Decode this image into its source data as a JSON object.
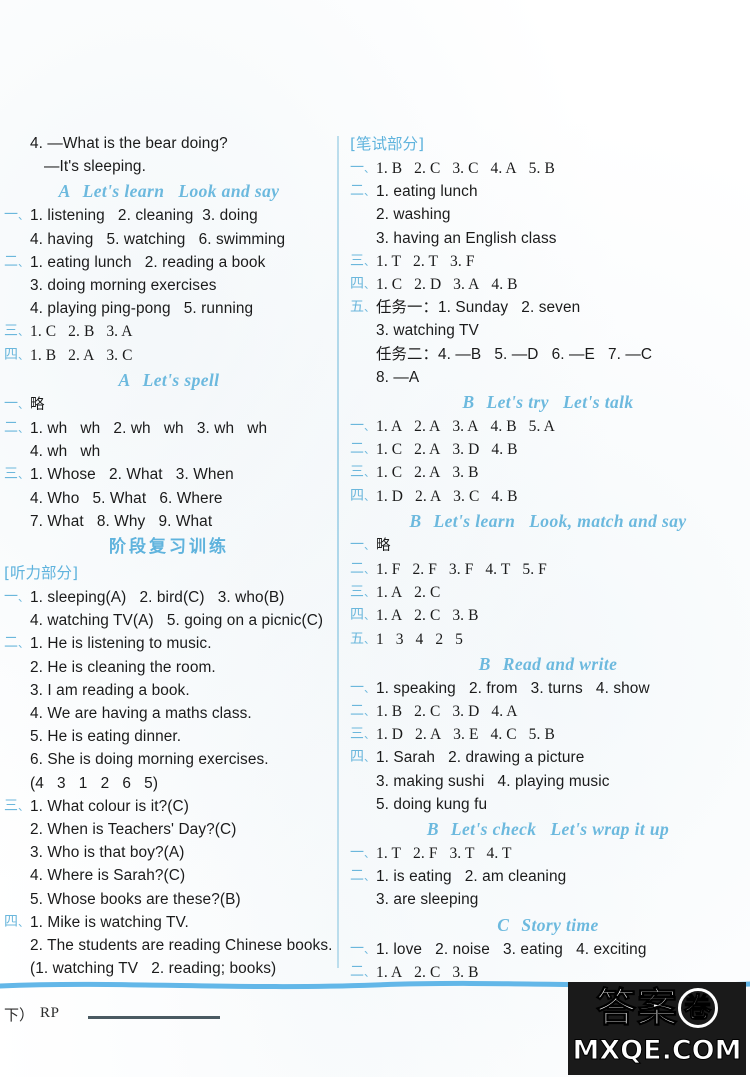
{
  "document": {
    "kind": "answer-key-page",
    "footer": {
      "page_label": "下）",
      "edition_code": "RP"
    },
    "watermark": {
      "chinese": "答案",
      "circled_char": "卷",
      "domain": "MXQE.COM"
    }
  },
  "left_column": {
    "blocks": [
      {
        "type": "lines",
        "lines": [
          {
            "indent": 1,
            "text": "4. —What is the bear doing?"
          },
          {
            "indent": 2,
            "text": "—It's sleeping."
          }
        ]
      },
      {
        "type": "heading",
        "tag": "A",
        "parts": [
          "Let's learn",
          "Look and say"
        ]
      },
      {
        "type": "numbered",
        "cn": "一",
        "lines": [
          "1. listening   2. cleaning  3. doing",
          "4. having   5. watching   6. swimming"
        ]
      },
      {
        "type": "numbered",
        "cn": "二",
        "lines": [
          "1. eating lunch   2. reading a book",
          "3. doing morning exercises",
          "4. playing ping-pong   5. running"
        ]
      },
      {
        "type": "numbered",
        "cn": "三",
        "serif": true,
        "lines": [
          "1. C   2. B   3. A"
        ]
      },
      {
        "type": "numbered",
        "cn": "四",
        "serif": true,
        "lines": [
          "1. B   2. A   3. C"
        ]
      },
      {
        "type": "heading",
        "tag": "A",
        "parts": [
          "Let's spell"
        ]
      },
      {
        "type": "numbered",
        "cn": "一",
        "lines": [
          "略"
        ],
        "cjk": true
      },
      {
        "type": "numbered",
        "cn": "二",
        "lines": [
          "1. wh   wh   2. wh   wh   3. wh   wh",
          "4. wh   wh"
        ]
      },
      {
        "type": "numbered",
        "cn": "三",
        "lines": [
          "1. Whose   2. What   3. When",
          "4. Who   5. What   6. Where",
          "7. What   8. Why   9. What"
        ]
      },
      {
        "type": "heading_cn",
        "text": "阶段复习训练"
      },
      {
        "type": "section_cn",
        "text": "[听力部分]"
      },
      {
        "type": "numbered",
        "cn": "一",
        "lines": [
          "1. sleeping(A)   2. bird(C)   3. who(B)",
          "4. watching TV(A)   5. going on a picnic(C)"
        ]
      },
      {
        "type": "numbered",
        "cn": "二",
        "lines": [
          "1. He is listening to music.",
          "2. He is cleaning the room.",
          "3. I am reading a book.",
          "4. We are having a maths class.",
          "5. He is eating dinner.",
          "6. She is doing morning exercises.",
          "(4   3   1   2   6   5)"
        ]
      },
      {
        "type": "numbered",
        "cn": "三",
        "lines": [
          "1. What colour is it?(C)",
          "2. When is Teachers' Day?(C)",
          "3. Who is that boy?(A)",
          "4. Where is Sarah?(C)",
          "5. Whose books are these?(B)"
        ]
      },
      {
        "type": "numbered",
        "cn": "四",
        "lines": [
          "1. Mike is watching TV.",
          "2. The students are reading Chinese books.",
          "(1. watching TV   2. reading; books)"
        ]
      }
    ]
  },
  "right_column": {
    "blocks": [
      {
        "type": "section_cn",
        "text": "[笔试部分]"
      },
      {
        "type": "numbered",
        "cn": "一",
        "serif": true,
        "lines": [
          "1. B   2. C   3. C   4. A   5. B"
        ]
      },
      {
        "type": "numbered",
        "cn": "二",
        "lines": [
          "1. eating lunch",
          "2. washing",
          "3. having an English class"
        ]
      },
      {
        "type": "numbered",
        "cn": "三",
        "serif": true,
        "lines": [
          "1. T   2. T   3. F"
        ]
      },
      {
        "type": "numbered",
        "cn": "四",
        "serif": true,
        "lines": [
          "1. C   2. D   3. A   4. B"
        ]
      },
      {
        "type": "numbered",
        "cn": "五",
        "lines": [
          "任务一：1. Sunday   2. seven",
          "3. watching TV",
          "任务二：4. —B   5. —D   6. —E   7. —C",
          "8. —A"
        ]
      },
      {
        "type": "heading",
        "tag": "B",
        "parts": [
          "Let's try",
          "Let's talk"
        ]
      },
      {
        "type": "numbered",
        "cn": "一",
        "serif": true,
        "lines": [
          "1. A   2. A   3. A   4. B   5. A"
        ]
      },
      {
        "type": "numbered",
        "cn": "二",
        "serif": true,
        "lines": [
          "1. C   2. A   3. D   4. B"
        ]
      },
      {
        "type": "numbered",
        "cn": "三",
        "serif": true,
        "lines": [
          "1. C   2. A   3. B"
        ]
      },
      {
        "type": "numbered",
        "cn": "四",
        "serif": true,
        "lines": [
          "1. D   2. A   3. C   4. B"
        ]
      },
      {
        "type": "heading",
        "tag": "B",
        "parts": [
          "Let's learn",
          "Look, match and say"
        ]
      },
      {
        "type": "numbered",
        "cn": "一",
        "lines": [
          "略"
        ],
        "cjk": true
      },
      {
        "type": "numbered",
        "cn": "二",
        "serif": true,
        "lines": [
          "1. F   2. F   3. F   4. T   5. F"
        ]
      },
      {
        "type": "numbered",
        "cn": "三",
        "serif": true,
        "lines": [
          "1. A   2. C"
        ]
      },
      {
        "type": "numbered",
        "cn": "四",
        "serif": true,
        "lines": [
          "1. A   2. C   3. B"
        ]
      },
      {
        "type": "numbered",
        "cn": "五",
        "serif": true,
        "lines": [
          "1   3   4   2   5"
        ]
      },
      {
        "type": "heading",
        "tag": "B",
        "parts": [
          "Read and write"
        ]
      },
      {
        "type": "numbered",
        "cn": "一",
        "lines": [
          "1. speaking   2. from   3. turns   4. show"
        ]
      },
      {
        "type": "numbered",
        "cn": "二",
        "serif": true,
        "lines": [
          "1. B   2. C   3. D   4. A"
        ]
      },
      {
        "type": "numbered",
        "cn": "三",
        "serif": true,
        "lines": [
          "1. D   2. A   3. E   4. C   5. B"
        ]
      },
      {
        "type": "numbered",
        "cn": "四",
        "lines": [
          "1. Sarah   2. drawing a picture",
          "3. making sushi   4. playing music",
          "5. doing kung fu"
        ]
      },
      {
        "type": "heading",
        "tag": "B",
        "parts": [
          "Let's check",
          "Let's wrap it up"
        ]
      },
      {
        "type": "numbered",
        "cn": "一",
        "serif": true,
        "lines": [
          "1. T   2. F   3. T   4. T"
        ]
      },
      {
        "type": "numbered",
        "cn": "二",
        "lines": [
          "1. is eating   2. am cleaning",
          "3. are sleeping"
        ]
      },
      {
        "type": "heading",
        "tag": "C",
        "parts": [
          "Story time"
        ]
      },
      {
        "type": "numbered",
        "cn": "一",
        "lines": [
          "1. love   2. noise   3. eating   4. exciting"
        ]
      },
      {
        "type": "numbered",
        "cn": "二",
        "serif": true,
        "lines": [
          "1. A   2. C   3. B"
        ]
      }
    ]
  },
  "colors": {
    "heading_blue": "#6cb9de",
    "cn_marker_blue": "#6bb7dc",
    "divider_blue": "#a8d4e8",
    "wave_blue": "#63b7e8",
    "body_black": "#1b1b1b"
  }
}
